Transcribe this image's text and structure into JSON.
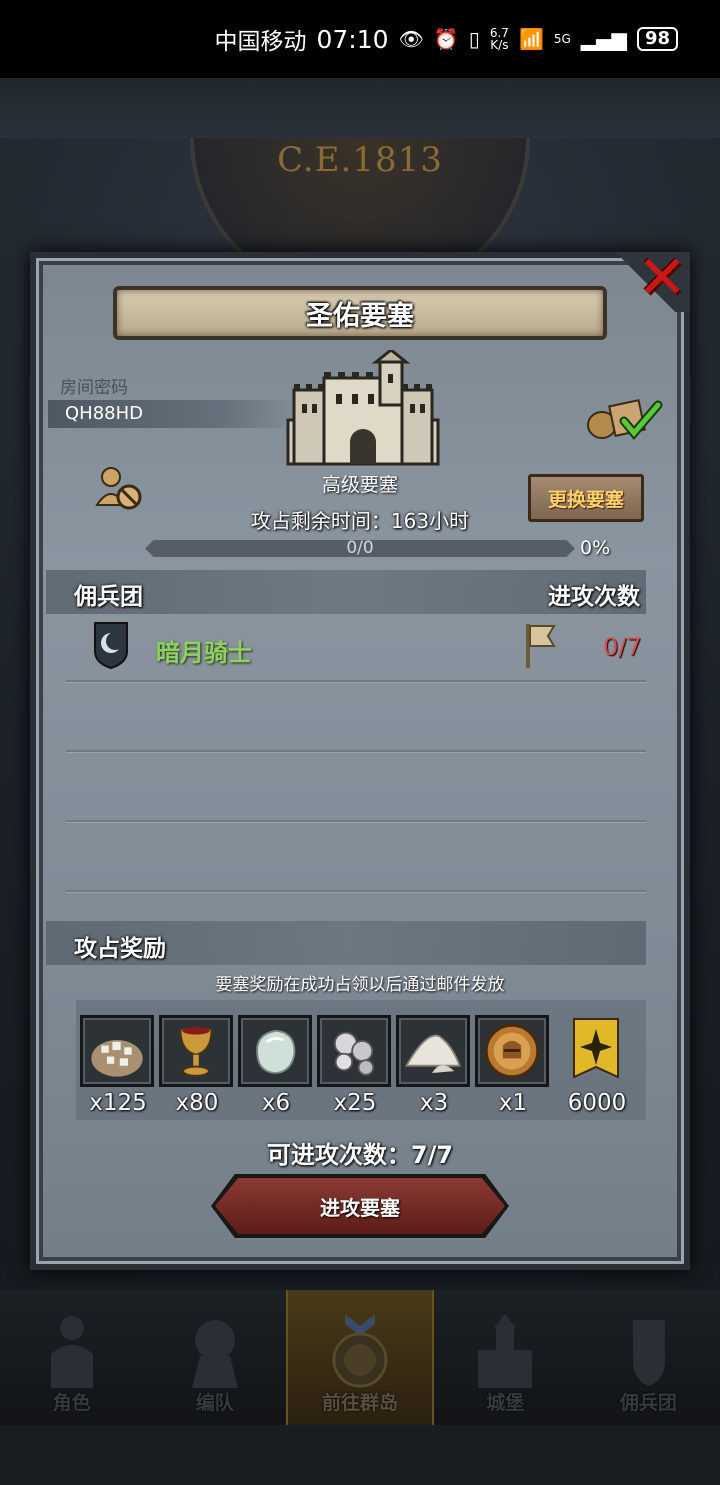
{
  "status_bar": {
    "carrier": "中国移动",
    "time": "07:10",
    "net_speed_top": "6.7",
    "net_speed_unit": "K/s",
    "network": "5G",
    "battery": "98"
  },
  "background": {
    "era": "C.E.1813"
  },
  "dialog": {
    "title": "圣佑要塞",
    "room_code_label": "房间密码",
    "room_code": "QH88HD",
    "fortress_type": "高级要塞",
    "change_fortress_label": "更换要塞",
    "remaining_time": "攻占剩余时间：163小时",
    "progress_text": "0/0",
    "progress_percent": "0%",
    "progress_value": 0,
    "mercenary_header": "佣兵团",
    "attack_count_header": "进攻次数",
    "mercenaries": [
      {
        "name": "暗月骑士",
        "attacks": "0/7"
      }
    ],
    "reward_header": "攻占奖励",
    "reward_note": "要塞奖励在成功占领以后通过邮件发放",
    "rewards": [
      {
        "icon": "ore-sack-icon",
        "qty": "x125"
      },
      {
        "icon": "goblet-icon",
        "qty": "x80"
      },
      {
        "icon": "gem-stone-icon",
        "qty": "x6"
      },
      {
        "icon": "silver-ore-icon",
        "qty": "x25"
      },
      {
        "icon": "salt-pile-icon",
        "qty": "x3"
      },
      {
        "icon": "knight-medal-icon",
        "qty": "x1"
      },
      {
        "icon": "guild-banner-icon",
        "qty": "6000"
      }
    ],
    "attempts_text": "可进攻次数：7/7",
    "attack_button_label": "进攻要塞"
  },
  "bottom_nav": [
    {
      "label": "角色",
      "icon": "knight-icon",
      "active": false
    },
    {
      "label": "编队",
      "icon": "formation-icon",
      "active": false
    },
    {
      "label": "前往群岛",
      "icon": "compass-icon",
      "active": true
    },
    {
      "label": "城堡",
      "icon": "castle-icon",
      "active": false
    },
    {
      "label": "佣兵团",
      "icon": "mercenary-icon",
      "active": false
    }
  ],
  "colors": {
    "merc_name": "#8ed15f",
    "attack_count": "#d05050",
    "change_button_text": "#ffd16b",
    "close_x": "#c81818"
  }
}
